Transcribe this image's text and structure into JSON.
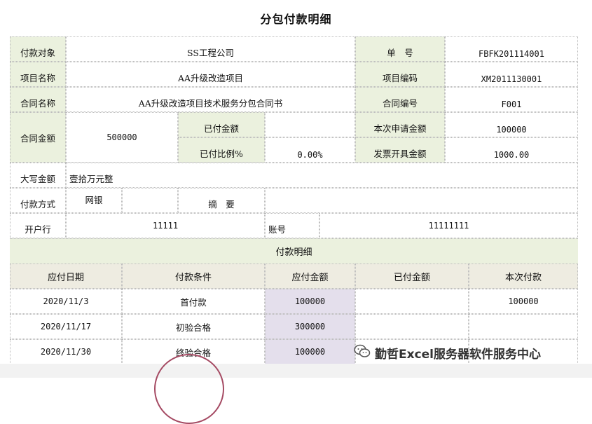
{
  "title": "分包付款明细",
  "fields": {
    "payee_label": "付款对象",
    "payee_value": "SS工程公司",
    "doc_no_label": "单　号",
    "doc_no_value": "FBFK201114001",
    "project_name_label": "项目名称",
    "project_name_value": "AA升级改造项目",
    "project_code_label": "项目编码",
    "project_code_value": "XM2011130001",
    "contract_name_label": "合同名称",
    "contract_name_value": "AA升级改造项目技术服务分包合同书",
    "contract_no_label": "合同编号",
    "contract_no_value": "F001",
    "contract_amount_label": "合同金额",
    "contract_amount_value": "500000",
    "paid_amount_label": "已付金额",
    "paid_amount_value": "",
    "apply_amount_label": "本次申请金额",
    "apply_amount_value": "100000",
    "paid_ratio_label": "已付比例%",
    "paid_ratio_value": "0.00%",
    "invoice_amount_label": "发票开具金额",
    "invoice_amount_value": "1000.00",
    "capital_label": "大写金额",
    "capital_value": "壹拾万元整",
    "method_label": "付款方式",
    "method_value": "网银",
    "summary_label": "摘　要",
    "summary_value": "",
    "bank_label": "开户行",
    "bank_value": "11111",
    "account_label": "账号",
    "account_value": "11111111"
  },
  "detail": {
    "section_title": "付款明细",
    "columns": [
      "应付日期",
      "付款条件",
      "应付金额",
      "已付金额",
      "本次付款"
    ],
    "rows": [
      [
        "2020/11/3",
        "首付款",
        "100000",
        "",
        "100000"
      ],
      [
        "2020/11/17",
        "初验合格",
        "300000",
        "",
        ""
      ],
      [
        "2020/11/30",
        "终验合格",
        "100000",
        "",
        ""
      ]
    ]
  },
  "watermark": {
    "text": "勤哲Excel服务器软件服务中心",
    "icon": "wechat-icon"
  }
}
